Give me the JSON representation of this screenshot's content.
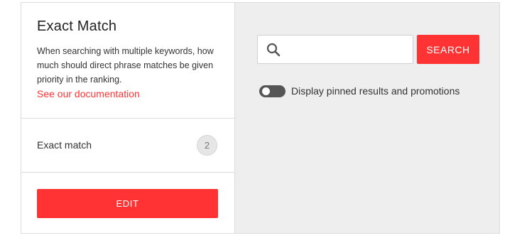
{
  "panel": {
    "title": "Exact Match",
    "description": "When searching with multiple keywords, how much should direct phrase matches be given priority in the ranking.",
    "doc_link": "See our documentation",
    "setting_label": "Exact match",
    "setting_value": "2",
    "edit_label": "EDIT"
  },
  "preview": {
    "search_value": "",
    "search_placeholder": "",
    "search_button": "SEARCH",
    "toggle_label": "Display pinned results and promotions",
    "toggle_on": false
  },
  "colors": {
    "accent": "#ff3333",
    "panel_bg": "#eeeeee",
    "toggle_off": "#555555"
  },
  "icons": {
    "search": "search-icon"
  }
}
